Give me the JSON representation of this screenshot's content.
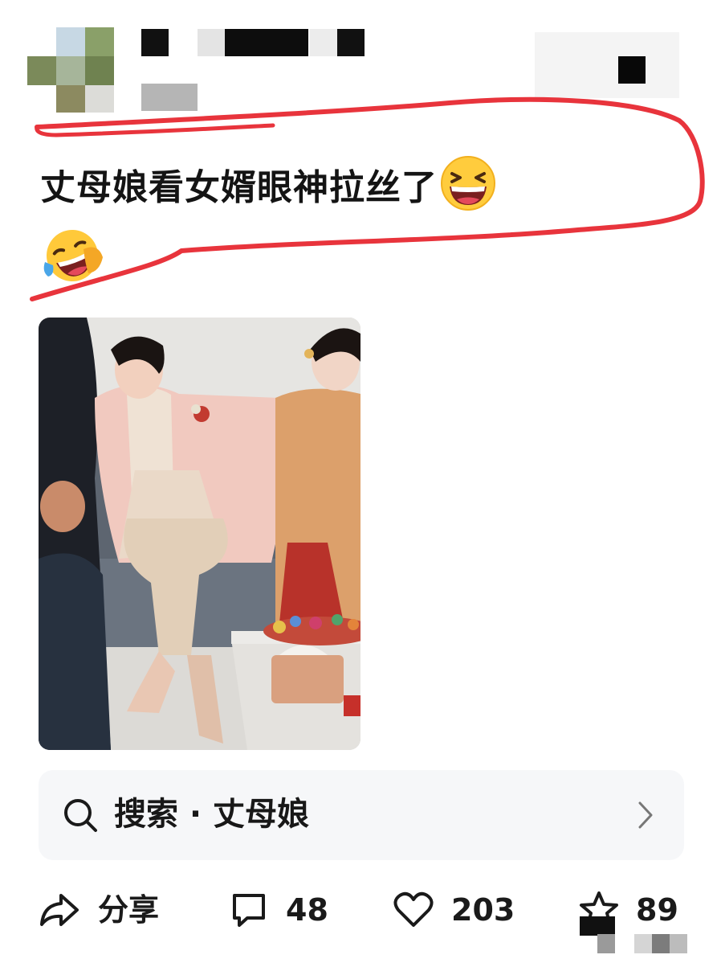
{
  "post": {
    "text": "丈母娘看女婿眼神拉丝了"
  },
  "search": {
    "label": "搜索 · 丈母娘"
  },
  "actions": {
    "share_label": "分享",
    "comment_count": "48",
    "like_count": "203",
    "favorite_count": "89"
  },
  "icons": {
    "laugh": "grinning-squinting-emoji",
    "cry_laugh": "rolling-laughing-emoji",
    "share": "share-arrow-icon",
    "comment": "comment-bubble-icon",
    "like": "heart-icon",
    "favorite": "star-icon",
    "search": "search-icon",
    "chevron": "chevron-right-icon"
  },
  "colors": {
    "annotation": "#e8343c",
    "text": "#141414",
    "search_bg": "#f6f7f9"
  }
}
